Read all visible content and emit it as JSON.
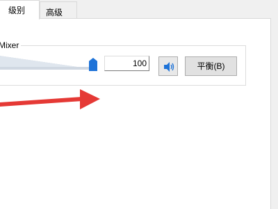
{
  "tabs": [
    {
      "label": "级别",
      "active": true
    },
    {
      "label": "高级",
      "active": false
    }
  ],
  "mixer": {
    "group_title": "Mixer",
    "level_value": "100",
    "slider_level": 100,
    "balance_label": "平衡(B)",
    "speaker_icon": "speaker-icon"
  },
  "annotation": {
    "arrow_color": "#e53935"
  }
}
